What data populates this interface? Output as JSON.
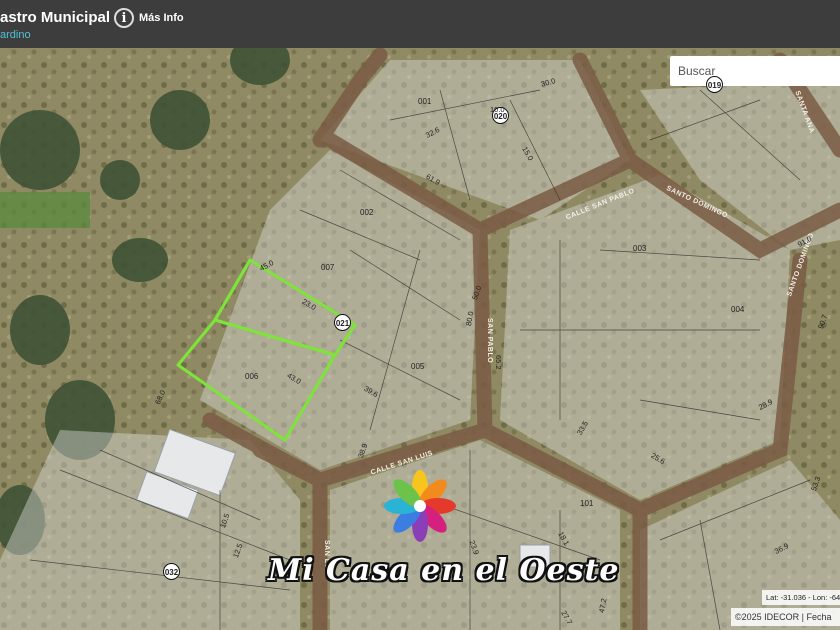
{
  "header": {
    "title": "astro Municipal",
    "subtitle": "ardino",
    "info_icon": "info-icon",
    "info_label": "Más Info"
  },
  "search": {
    "placeholder": "Buscar"
  },
  "map": {
    "block_numbers": [
      "019",
      "020",
      "021",
      "032"
    ],
    "parcel_numbers": [
      "001",
      "002",
      "003",
      "004",
      "005",
      "006",
      "007",
      "101",
      "006+"
    ],
    "streets": [
      "CALLE SAN PABLO",
      "SANTO DOMINGO",
      "SAN PABLO",
      "CALLE SAN LUIS",
      "SAN LUIS",
      "SANTA ANA",
      "SANTO DOMINGO"
    ],
    "measurements": [
      "45.0",
      "23.0",
      "39.6",
      "30.0",
      "68.0",
      "10.0",
      "32.6",
      "15.0",
      "65.2",
      "28.9",
      "53.3",
      "91.0",
      "90.7",
      "27.7",
      "23.9",
      "18.1",
      "33.5",
      "12.5",
      "43.0",
      "61.9",
      "50.0",
      "10.5",
      "38.9",
      "36.9",
      "25.6",
      "47.2",
      "80.0"
    ],
    "highlight_color": "#7ee43a",
    "road_color": "#7a5c45",
    "lot_tint": "#d8d8d4"
  },
  "footer": {
    "coords": "Lat: -31.036 - Lon: -64.4",
    "attribution": "©2025 IDECOR | Fecha"
  },
  "watermark": {
    "text": "Mi Casa en el Oeste"
  }
}
